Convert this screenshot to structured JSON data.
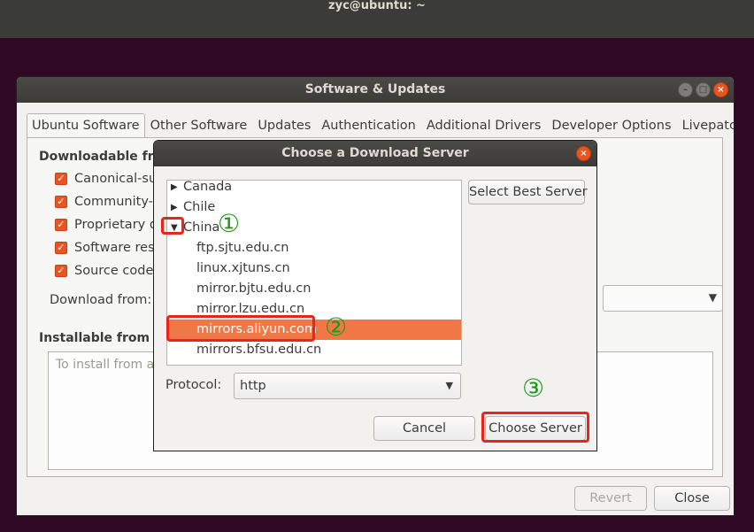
{
  "terminal": {
    "title": "zyc@ubuntu: ~"
  },
  "main_window": {
    "title": "Software & Updates",
    "controls": {
      "minimize": "–",
      "maximize": "□",
      "close": "×"
    },
    "tabs": [
      {
        "label": "Ubuntu Software",
        "active": true
      },
      {
        "label": "Other Software"
      },
      {
        "label": "Updates"
      },
      {
        "label": "Authentication"
      },
      {
        "label": "Additional Drivers"
      },
      {
        "label": "Developer Options"
      },
      {
        "label": "Livepatch"
      }
    ],
    "downloadable_heading": "Downloadable from",
    "checkboxes": [
      {
        "label": "Canonical-supp",
        "checked": true
      },
      {
        "label": "Community-m",
        "checked": true
      },
      {
        "label": "Proprietary dr",
        "checked": true
      },
      {
        "label": "Software restr",
        "checked": true
      },
      {
        "label": "Source code",
        "checked": true
      }
    ],
    "download_from_label": "Download from:",
    "installable_heading": "Installable from C",
    "installable_placeholder": "To install from a",
    "revert_button": "Revert",
    "close_button": "Close"
  },
  "dialog": {
    "title": "Choose a Download Server",
    "close_glyph": "×",
    "tree": [
      {
        "label": "Canada",
        "level": 0,
        "expanded": false
      },
      {
        "label": "Chile",
        "level": 0,
        "expanded": false
      },
      {
        "label": "China",
        "level": 0,
        "expanded": true
      },
      {
        "label": "ftp.sjtu.edu.cn",
        "level": 1
      },
      {
        "label": "linux.xjtuns.cn",
        "level": 1
      },
      {
        "label": "mirror.bjtu.edu.cn",
        "level": 1
      },
      {
        "label": "mirror.lzu.edu.cn",
        "level": 1
      },
      {
        "label": "mirrors.aliyun.com",
        "level": 1,
        "selected": true
      },
      {
        "label": "mirrors.bfsu.edu.cn",
        "level": 1
      }
    ],
    "select_best_button": "Select Best Server",
    "protocol_label": "Protocol:",
    "protocol_value": "http",
    "cancel_button": "Cancel",
    "choose_button": "Choose Server"
  },
  "annotations": {
    "step1": "①",
    "step2": "②",
    "step3": "③"
  },
  "colors": {
    "accent": "#e95420",
    "selection": "#f07746",
    "annotation_box": "#e8241b",
    "annotation_num": "#1a9c1a"
  }
}
